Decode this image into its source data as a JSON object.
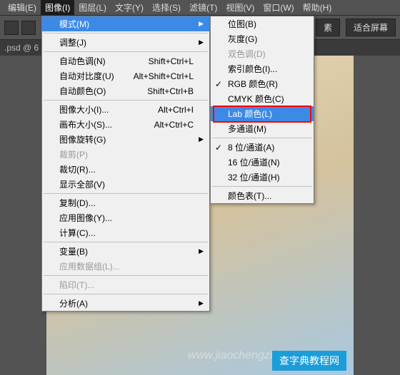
{
  "menubar": [
    "编辑(E)",
    "图像(I)",
    "图层(L)",
    "文字(Y)",
    "选择(S)",
    "滤镜(T)",
    "视图(V)",
    "窗口(W)",
    "帮助(H)"
  ],
  "menubar_active": 1,
  "toolbar_buttons": [
    "素",
    "适合屏幕"
  ],
  "tab": ".psd @ 6",
  "dropdown": [
    {
      "t": "hi",
      "label": "模式(M)",
      "arrow": true
    },
    {
      "t": "sep"
    },
    {
      "t": "item",
      "label": "调整(J)",
      "arrow": true
    },
    {
      "t": "sep"
    },
    {
      "t": "item",
      "label": "自动色调(N)",
      "sc": "Shift+Ctrl+L"
    },
    {
      "t": "item",
      "label": "自动对比度(U)",
      "sc": "Alt+Shift+Ctrl+L"
    },
    {
      "t": "item",
      "label": "自动颜色(O)",
      "sc": "Shift+Ctrl+B"
    },
    {
      "t": "sep"
    },
    {
      "t": "item",
      "label": "图像大小(I)...",
      "sc": "Alt+Ctrl+I"
    },
    {
      "t": "item",
      "label": "画布大小(S)...",
      "sc": "Alt+Ctrl+C"
    },
    {
      "t": "item",
      "label": "图像旋转(G)",
      "arrow": true
    },
    {
      "t": "disabled",
      "label": "裁剪(P)"
    },
    {
      "t": "item",
      "label": "裁切(R)..."
    },
    {
      "t": "item",
      "label": "显示全部(V)"
    },
    {
      "t": "sep"
    },
    {
      "t": "item",
      "label": "复制(D)..."
    },
    {
      "t": "item",
      "label": "应用图像(Y)..."
    },
    {
      "t": "item",
      "label": "计算(C)..."
    },
    {
      "t": "sep"
    },
    {
      "t": "item",
      "label": "变量(B)",
      "arrow": true
    },
    {
      "t": "disabled",
      "label": "应用数据组(L)..."
    },
    {
      "t": "sep"
    },
    {
      "t": "disabled",
      "label": "陷印(T)..."
    },
    {
      "t": "sep"
    },
    {
      "t": "item",
      "label": "分析(A)",
      "arrow": true
    }
  ],
  "submenu": [
    {
      "t": "item",
      "label": "位图(B)"
    },
    {
      "t": "item",
      "label": "灰度(G)"
    },
    {
      "t": "disabled",
      "label": "双色调(D)"
    },
    {
      "t": "item",
      "label": "索引颜色(I)..."
    },
    {
      "t": "item",
      "label": "RGB 颜色(R)",
      "check": true
    },
    {
      "t": "item",
      "label": "CMYK 颜色(C)"
    },
    {
      "t": "hi",
      "label": "Lab 颜色(L)"
    },
    {
      "t": "item",
      "label": "多通道(M)"
    },
    {
      "t": "sep"
    },
    {
      "t": "item",
      "label": "8 位/通道(A)",
      "check": true
    },
    {
      "t": "item",
      "label": "16 位/通道(N)"
    },
    {
      "t": "item",
      "label": "32 位/通道(H)"
    },
    {
      "t": "sep"
    },
    {
      "t": "item",
      "label": "颜色表(T)..."
    }
  ],
  "watermark": "www.jiaochengzhi.com",
  "brand": "查字典教程网"
}
